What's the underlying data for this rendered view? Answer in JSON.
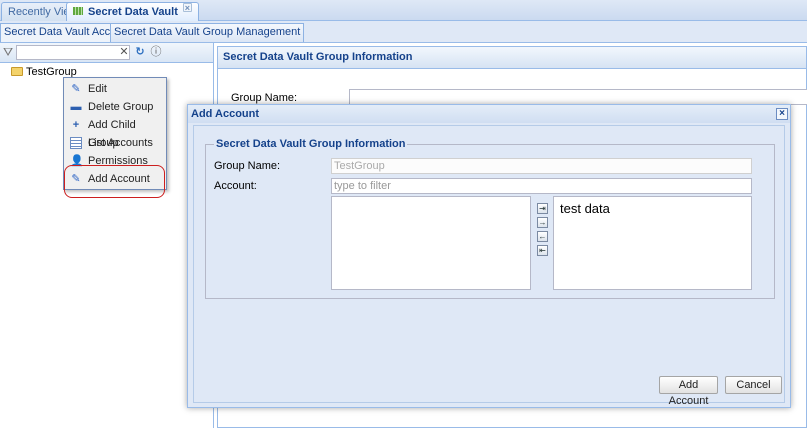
{
  "top_tabs": [
    {
      "label": "Recently View"
    },
    {
      "label": "Secret Data Vault",
      "active": true
    }
  ],
  "sub_tabs": [
    {
      "label": "Secret Data Vault Accounts",
      "active": true
    },
    {
      "label": "Secret Data Vault Group Management"
    }
  ],
  "tree": {
    "search_value": "",
    "root_label": "TestGroup"
  },
  "context_menu": {
    "items": [
      {
        "label": "Edit",
        "icon": "pencil-icon"
      },
      {
        "label": "Delete Group",
        "icon": "minus-icon"
      },
      {
        "label": "Add Child Group",
        "icon": "plus-icon"
      },
      {
        "label": "List Accounts",
        "icon": "list-icon"
      },
      {
        "label": "Permissions",
        "icon": "user-icon"
      },
      {
        "label": "Add Account",
        "icon": "pencil-icon",
        "highlighted": true
      }
    ],
    "highlight_color": "#cc1f1f"
  },
  "right_panel": {
    "title": "Secret Data Vault Group Information",
    "group_name_label": "Group Name:"
  },
  "modal": {
    "title": "Add Account",
    "fieldset_title": "Secret Data Vault Group Information",
    "group_name_label": "Group Name:",
    "group_name_value": "TestGroup",
    "account_label": "Account:",
    "account_placeholder": "type to filter",
    "available_items": [],
    "selected_items": [
      "test data"
    ],
    "move_buttons": [
      "move-right-icon",
      "move-all-right-icon",
      "move-left-icon",
      "move-all-left-icon"
    ],
    "add_button": "Add Account",
    "cancel_button": "Cancel"
  },
  "colors": {
    "panel_bg": "#dfe8f6",
    "border": "#99bbe8",
    "header_text": "#15428b"
  }
}
